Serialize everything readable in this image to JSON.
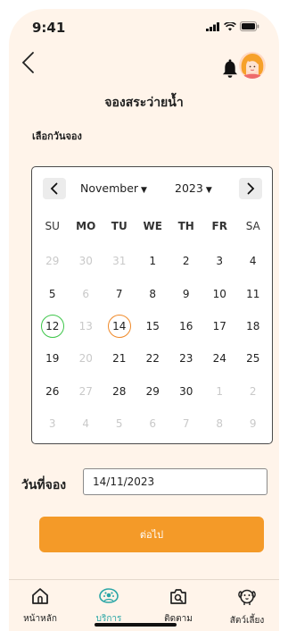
{
  "status_bar": {
    "time": "9:41"
  },
  "header": {
    "title": "จองสระว่ายน้ำ"
  },
  "section": {
    "label": "เลือกวันจอง"
  },
  "calendar": {
    "month": "November",
    "year": "2023",
    "weekdays": [
      "SU",
      "MO",
      "TU",
      "WE",
      "TH",
      "FR",
      "SA"
    ],
    "bold_weekdays": [
      "MO",
      "TU",
      "WE",
      "TH",
      "FR"
    ],
    "today": "12",
    "selected": "14",
    "days": [
      {
        "label": "29",
        "state": "muted"
      },
      {
        "label": "30",
        "state": "muted"
      },
      {
        "label": "31",
        "state": "muted"
      },
      {
        "label": "1",
        "state": "normal"
      },
      {
        "label": "2",
        "state": "normal"
      },
      {
        "label": "3",
        "state": "normal"
      },
      {
        "label": "4",
        "state": "normal"
      },
      {
        "label": "5",
        "state": "normal"
      },
      {
        "label": "6",
        "state": "disabled"
      },
      {
        "label": "7",
        "state": "normal"
      },
      {
        "label": "8",
        "state": "normal"
      },
      {
        "label": "9",
        "state": "normal"
      },
      {
        "label": "10",
        "state": "normal"
      },
      {
        "label": "11",
        "state": "normal"
      },
      {
        "label": "12",
        "state": "today"
      },
      {
        "label": "13",
        "state": "disabled"
      },
      {
        "label": "14",
        "state": "selected"
      },
      {
        "label": "15",
        "state": "normal"
      },
      {
        "label": "16",
        "state": "normal"
      },
      {
        "label": "17",
        "state": "normal"
      },
      {
        "label": "18",
        "state": "normal"
      },
      {
        "label": "19",
        "state": "normal"
      },
      {
        "label": "20",
        "state": "disabled"
      },
      {
        "label": "21",
        "state": "normal"
      },
      {
        "label": "22",
        "state": "normal"
      },
      {
        "label": "23",
        "state": "normal"
      },
      {
        "label": "24",
        "state": "normal"
      },
      {
        "label": "25",
        "state": "normal"
      },
      {
        "label": "26",
        "state": "normal"
      },
      {
        "label": "27",
        "state": "disabled"
      },
      {
        "label": "28",
        "state": "normal"
      },
      {
        "label": "29",
        "state": "normal"
      },
      {
        "label": "30",
        "state": "normal"
      },
      {
        "label": "1",
        "state": "muted"
      },
      {
        "label": "2",
        "state": "muted"
      },
      {
        "label": "3",
        "state": "muted"
      },
      {
        "label": "4",
        "state": "muted"
      },
      {
        "label": "5",
        "state": "muted"
      },
      {
        "label": "6",
        "state": "muted"
      },
      {
        "label": "7",
        "state": "muted"
      },
      {
        "label": "8",
        "state": "muted"
      },
      {
        "label": "9",
        "state": "muted"
      }
    ]
  },
  "booking": {
    "label": "วันที่จอง",
    "date_value": "14/11/2023"
  },
  "next_button": {
    "label": "ต่อไป"
  },
  "tab_bar": {
    "items": [
      {
        "label": "หน้าหลัก",
        "icon": "home-icon"
      },
      {
        "label": "บริการ",
        "icon": "services-icon"
      },
      {
        "label": "ติดตาม",
        "icon": "tracking-icon"
      },
      {
        "label": "สัตว์เลี้ยง",
        "icon": "pet-icon"
      }
    ],
    "active_index": 1
  },
  "colors": {
    "background": "#fff4ea",
    "accent_orange": "#f49a28",
    "today_ring": "#3ec64a",
    "selected_ring": "#f08a2a",
    "active_tab": "#2aa6a6"
  }
}
